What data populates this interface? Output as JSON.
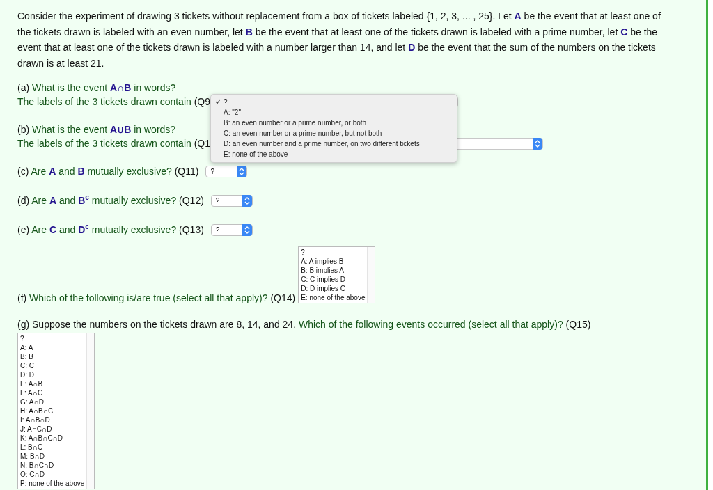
{
  "intro": "Consider the experiment of drawing 3 tickets without replacement from a box of tickets labeled {1, 2, 3, ... , 25}. Let **A** be the event that at least one of the tickets drawn is labeled with an even number, let **B** be the event that at least one of the tickets drawn is labeled with a prime number, let **C** be the event that at least one of the tickets drawn is labeled with a number larger than 14, and let **D** be the event that the sum of the numbers on the tickets drawn is at least 21.",
  "questions": [
    {
      "kind": "words",
      "label": "(a)",
      "text": "What is the event **A∩B** in words?",
      "prompt": "The labels of the 3 tickets drawn contain",
      "qid": "(Q9",
      "menu": [
        {
          "label": "?",
          "selected": true
        },
        {
          "label": "A: \"2\"",
          "selected": false
        },
        {
          "label": "B: an even number or a prime number, or both",
          "selected": false
        },
        {
          "label": "C: an even number or a prime number, but not both",
          "selected": false
        },
        {
          "label": "D: an even number and a prime number, on two different tickets",
          "selected": false
        },
        {
          "label": "E: none of the above",
          "selected": false
        }
      ]
    },
    {
      "kind": "words",
      "label": "(b)",
      "text": "What is the event **A∪B** in words?",
      "prompt": "The labels of the 3 tickets drawn contain",
      "qid": "(Q1"
    },
    {
      "kind": "dropdown",
      "label": "(c)",
      "text": "Are **A** and **B** mutually exclusive?",
      "qid": "(Q11)",
      "value": "?"
    },
    {
      "kind": "dropdown",
      "label": "(d)",
      "text": "Are **A** and **B$^{c}$** mutually exclusive?",
      "qid": "(Q12)",
      "value": "?"
    },
    {
      "kind": "dropdown",
      "label": "(e)",
      "text": "Are **C** and **D$^{c}$** mutually exclusive?",
      "qid": "(Q13)",
      "value": "?"
    },
    {
      "kind": "listbox",
      "label": "(f)",
      "text": "Which of the following is/are true (select all that apply)?",
      "qid": "(Q14)",
      "options": [
        "?",
        "A: A implies B",
        "B: B implies A",
        "C: C implies D",
        "D: D implies C",
        "E: none of the above"
      ]
    },
    {
      "kind": "listbox-below",
      "label": "(g)",
      "context": "Suppose the numbers on the tickets drawn are 8, 14, and 24.",
      "text": "Which of the following events occurred (select all that apply)?",
      "qid": "(Q15)",
      "options": [
        "?",
        "A: A",
        "B: B",
        "C: C",
        "D: D",
        "E: A∩B",
        "F: A∩C",
        "G: A∩D",
        "H: A∩B∩C",
        "I: A∩B∩D",
        "J: A∩C∩D",
        "K: A∩B∩C∩D",
        "L: B∩C",
        "M: B∩D",
        "N: B∩C∩D",
        "O: C∩D",
        "P: none of the above"
      ]
    }
  ]
}
